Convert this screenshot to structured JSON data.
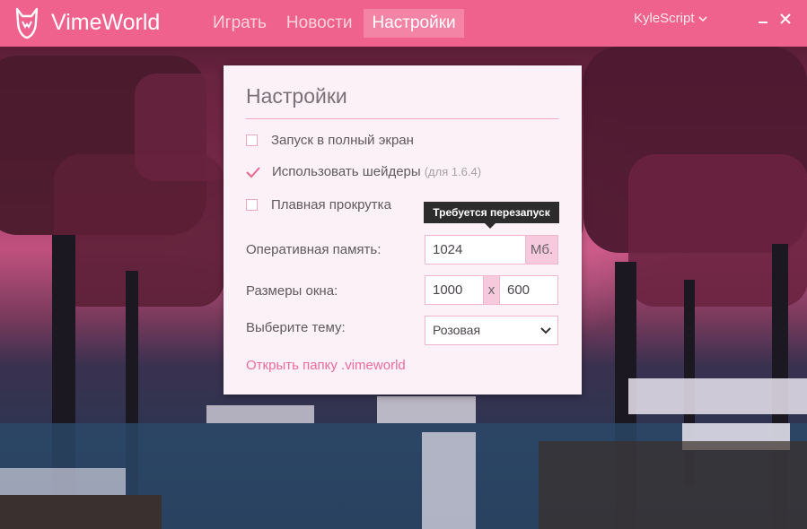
{
  "app": {
    "brand": "VimeWorld",
    "accent_color": "#f0628e",
    "logo_icon": "fox-logo-icon"
  },
  "nav": {
    "items": [
      {
        "label": "Играть",
        "active": false
      },
      {
        "label": "Новости",
        "active": false
      },
      {
        "label": "Настройки",
        "active": true
      }
    ]
  },
  "user": {
    "name": "KyleScript",
    "menu_icon": "chevron-down-icon"
  },
  "window_controls": {
    "minimize_icon": "minimize-icon",
    "close_icon": "close-icon"
  },
  "settings": {
    "title": "Настройки",
    "options": [
      {
        "label": "Запуск в полный экран",
        "checked": false,
        "note": ""
      },
      {
        "label": "Использовать шейдеры",
        "checked": true,
        "note": "(для 1.6.4)"
      },
      {
        "label": "Плавная прокрутка",
        "checked": false,
        "note": ""
      }
    ],
    "memory": {
      "label": "Оперативная память:",
      "value": "1024",
      "unit": "Мб.",
      "tooltip": "Требуется перезапуск"
    },
    "window_size": {
      "label": "Размеры окна:",
      "width": "1000",
      "separator": "x",
      "height": "600"
    },
    "theme": {
      "label": "Выберите тему:",
      "selected": "Розовая"
    },
    "open_folder_link": "Открыть папку .vimeworld"
  }
}
